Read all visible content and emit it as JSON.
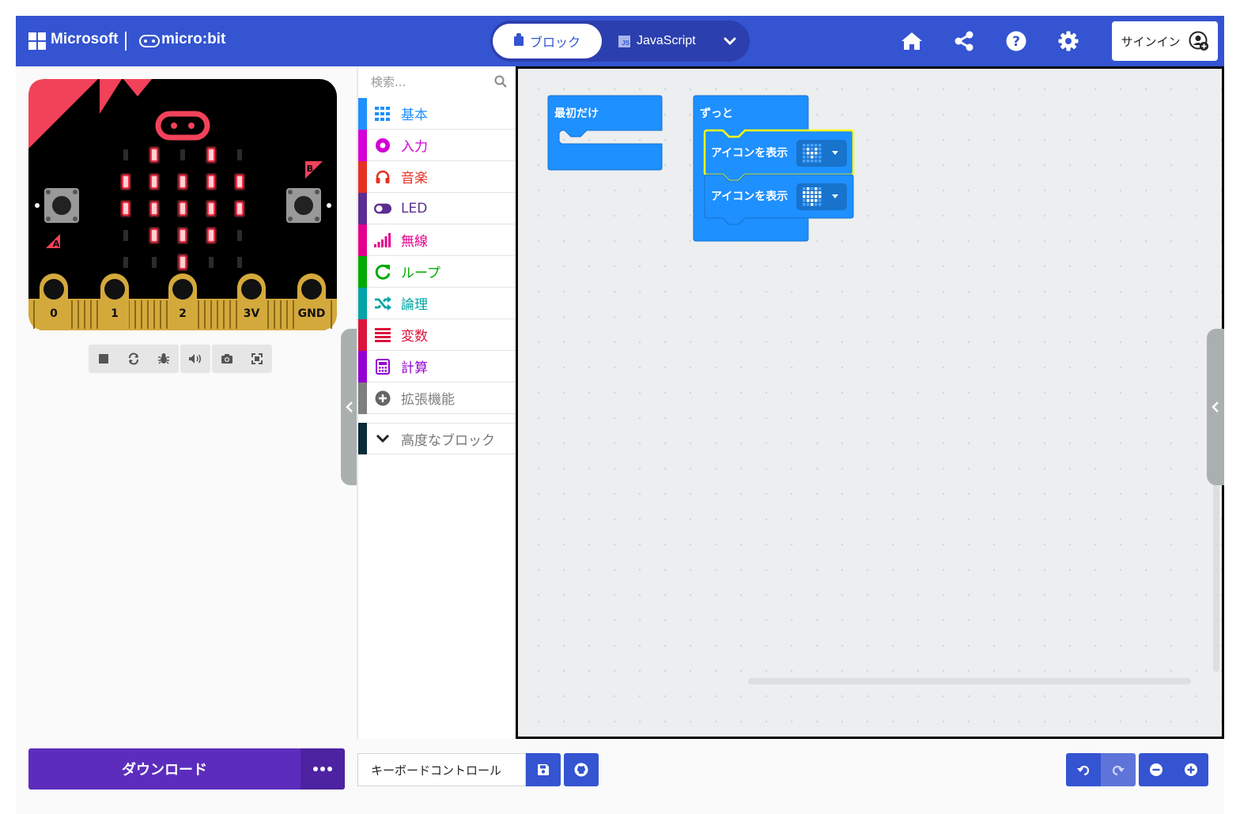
{
  "header": {
    "brand": "Microsoft",
    "product": "micro:bit",
    "editor_blocks_label": "ブロック",
    "editor_js_label": "JavaScript",
    "js_icon_text": "JS",
    "signin_label": "サインイン",
    "icons": [
      "home-icon",
      "share-icon",
      "help-icon",
      "settings-icon",
      "chevron-down-icon",
      "user-add-icon"
    ]
  },
  "simulator": {
    "pin_labels": [
      "0",
      "1",
      "2",
      "3V",
      "GND"
    ],
    "button_a": "A",
    "button_b": "B",
    "led_matrix": [
      [
        0,
        1,
        0,
        1,
        0
      ],
      [
        1,
        1,
        1,
        1,
        1
      ],
      [
        1,
        1,
        1,
        1,
        1
      ],
      [
        0,
        1,
        1,
        1,
        0
      ],
      [
        0,
        0,
        1,
        0,
        0
      ]
    ],
    "toolbar_icons": [
      "stop-icon",
      "restart-icon",
      "debug-icon",
      "sound-icon",
      "screenshot-icon",
      "fullscreen-icon"
    ]
  },
  "toolbox": {
    "search_placeholder": "検索...",
    "categories": [
      {
        "label": "基本",
        "color": "#1e90ff",
        "icon": "grid-icon"
      },
      {
        "label": "入力",
        "color": "#d400d4",
        "icon": "input-icon"
      },
      {
        "label": "音楽",
        "color": "#e63022",
        "icon": "headphones-icon"
      },
      {
        "label": "LED",
        "color": "#5c2d91",
        "icon": "toggle-icon"
      },
      {
        "label": "無線",
        "color": "#e3008c",
        "icon": "signal-icon"
      },
      {
        "label": "ループ",
        "color": "#00aa00",
        "icon": "loop-icon"
      },
      {
        "label": "論理",
        "color": "#00a4a6",
        "icon": "shuffle-icon"
      },
      {
        "label": "変数",
        "color": "#dc143c",
        "icon": "variables-icon"
      },
      {
        "label": "計算",
        "color": "#9400d3",
        "icon": "calculator-icon"
      },
      {
        "label": "拡張機能",
        "color": "#7f7f7f",
        "icon": "plus-circle-icon"
      }
    ],
    "advanced": {
      "label": "高度なブロック",
      "color": "#0b2b36",
      "icon": "chevron-down-icon"
    }
  },
  "workspace": {
    "on_start_label": "最初だけ",
    "forever_label": "ずっと",
    "show_icon_label_1": "アイコンを表示",
    "show_icon_label_2": "アイコンを表示",
    "block_color": "#1e90ff",
    "highlight_color": "#ffff00"
  },
  "footer": {
    "download_label": "ダウンロード",
    "project_name": "キーボードコントロール",
    "icons": [
      "more-icon",
      "save-icon",
      "github-icon",
      "undo-icon",
      "redo-icon",
      "zoom-out-icon",
      "zoom-in-icon"
    ]
  }
}
